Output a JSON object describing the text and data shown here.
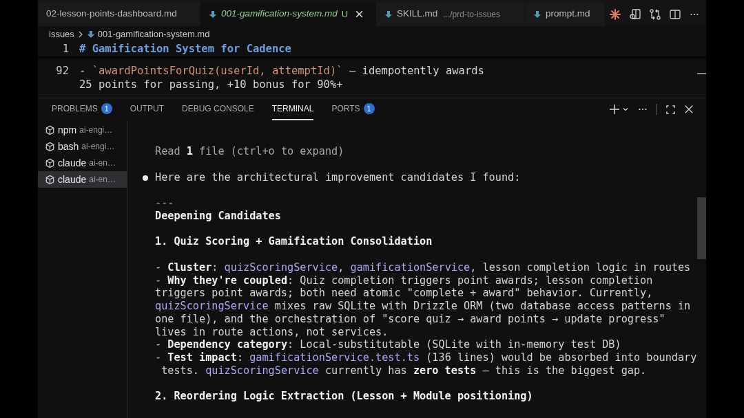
{
  "editor_tabs": [
    {
      "label": "02-lesson-points-dashboard.md",
      "selected": false
    },
    {
      "label": "001-gamification-system.md",
      "badge": "U",
      "selected": true
    },
    {
      "label": "SKILL.md",
      "detail": ".../prd-to-issues",
      "selected": false
    },
    {
      "label": "prompt.md",
      "selected": false
    }
  ],
  "breadcrumb": [
    "issues",
    "001-gamification-system.md"
  ],
  "editor_lines": [
    {
      "number": "1",
      "kind": "heading",
      "segments": [
        {
          "kind": "heading",
          "text": "# Gamification System for Cadence"
        }
      ]
    },
    {
      "number": "92",
      "kind": "text",
      "segments": [
        {
          "kind": "plain",
          "text": "- "
        },
        {
          "kind": "code",
          "text": "`awardPointsForQuiz(userId, attemptId)`"
        },
        {
          "kind": "plain",
          "text": " — idempotently awards"
        }
      ]
    },
    {
      "kind": "text",
      "segments": [
        {
          "kind": "plain",
          "text": "25 points for passing, +10 bonus for 90%+"
        }
      ]
    }
  ],
  "panel_tabs": [
    {
      "label": "PROBLEMS",
      "badge": "1",
      "selected": false
    },
    {
      "label": "OUTPUT",
      "selected": false
    },
    {
      "label": "DEBUG CONSOLE",
      "selected": false
    },
    {
      "label": "TERMINAL",
      "selected": true
    },
    {
      "label": "PORTS",
      "badge": "1",
      "selected": false
    }
  ],
  "terminals": [
    {
      "name": "npm",
      "detail": "ai-engi…",
      "selected": false
    },
    {
      "name": "bash",
      "detail": "ai-engi…",
      "selected": false
    },
    {
      "name": "claude",
      "detail": "ai-en…",
      "selected": false
    },
    {
      "name": "claude",
      "detail": "ai-en…",
      "selected": true
    }
  ],
  "terminal_lines": [
    {
      "kind": "dim",
      "segments": [
        {
          "kind": "plain",
          "text": "Read "
        },
        {
          "kind": "bold",
          "text": "1"
        },
        {
          "kind": "plain",
          "text": " file (ctrl+o to expand)"
        }
      ]
    },
    {
      "kind": "blank"
    },
    {
      "kind": "bullet",
      "segments": [
        {
          "kind": "plain",
          "text": "Here are the architectural improvement candidates I found:"
        }
      ]
    },
    {
      "kind": "blank"
    },
    {
      "kind": "dim",
      "segments": [
        {
          "kind": "plain",
          "text": "---"
        }
      ]
    },
    {
      "kind": "text",
      "segments": [
        {
          "kind": "bold",
          "text": "Deepening Candidates"
        }
      ]
    },
    {
      "kind": "blank"
    },
    {
      "kind": "text",
      "segments": [
        {
          "kind": "bold",
          "text": "1. Quiz Scoring + Gamification Consolidation"
        }
      ]
    },
    {
      "kind": "blank"
    },
    {
      "kind": "text",
      "segments": [
        {
          "kind": "plain",
          "text": "- "
        },
        {
          "kind": "bold",
          "text": "Cluster"
        },
        {
          "kind": "plain",
          "text": ": "
        },
        {
          "kind": "link",
          "text": "quizScoringService"
        },
        {
          "kind": "plain",
          "text": ", "
        },
        {
          "kind": "link",
          "text": "gamificationService"
        },
        {
          "kind": "plain",
          "text": ", lesson completion logic in routes"
        }
      ]
    },
    {
      "kind": "text",
      "segments": [
        {
          "kind": "plain",
          "text": "- "
        },
        {
          "kind": "bold",
          "text": "Why they're coupled"
        },
        {
          "kind": "plain",
          "text": ": Quiz completion triggers point awards; lesson completion"
        }
      ]
    },
    {
      "kind": "text",
      "segments": [
        {
          "kind": "plain",
          "text": "triggers point awards; both need atomic \"complete + award\" behavior. Currently,"
        }
      ]
    },
    {
      "kind": "text",
      "segments": [
        {
          "kind": "link",
          "text": "quizScoringService"
        },
        {
          "kind": "plain",
          "text": " mixes raw SQLite with Drizzle ORM (two database access patterns in"
        }
      ]
    },
    {
      "kind": "text",
      "segments": [
        {
          "kind": "plain",
          "text": "one file), and the orchestration of \"score quiz → award points → update progress\""
        }
      ]
    },
    {
      "kind": "text",
      "segments": [
        {
          "kind": "plain",
          "text": "lives in route actions, not services."
        }
      ]
    },
    {
      "kind": "text",
      "segments": [
        {
          "kind": "plain",
          "text": "- "
        },
        {
          "kind": "bold",
          "text": "Dependency category"
        },
        {
          "kind": "plain",
          "text": ": Local-substitutable (SQLite with in-memory test DB)"
        }
      ]
    },
    {
      "kind": "text",
      "segments": [
        {
          "kind": "plain",
          "text": "- "
        },
        {
          "kind": "bold",
          "text": "Test impact"
        },
        {
          "kind": "plain",
          "text": ": "
        },
        {
          "kind": "link",
          "text": "gamificationService.test.ts"
        },
        {
          "kind": "plain",
          "text": " (136 lines) would be absorbed into boundary"
        }
      ]
    },
    {
      "kind": "text",
      "segments": [
        {
          "kind": "plain",
          "text": " tests. "
        },
        {
          "kind": "link",
          "text": "quizScoringService"
        },
        {
          "kind": "plain",
          "text": " currently has "
        },
        {
          "kind": "bold",
          "text": "zero tests"
        },
        {
          "kind": "plain",
          "text": " — this is the biggest gap."
        }
      ]
    },
    {
      "kind": "blank"
    },
    {
      "kind": "text",
      "segments": [
        {
          "kind": "bold",
          "text": "2. Reordering Logic Extraction (Lesson + Module positioning)"
        }
      ]
    }
  ]
}
